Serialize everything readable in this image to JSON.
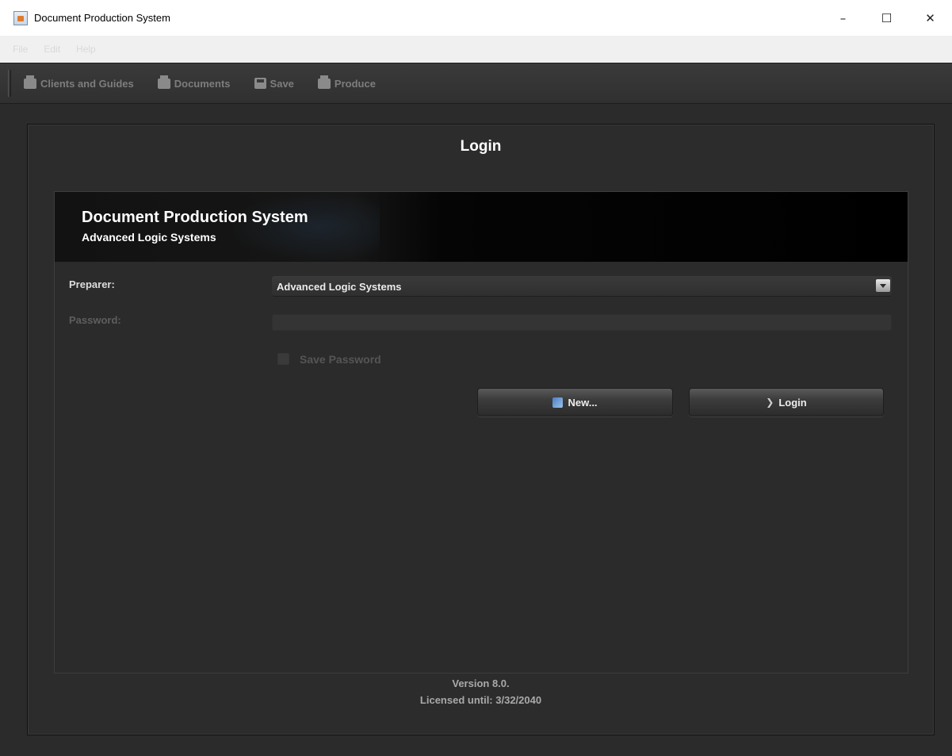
{
  "window": {
    "title": "Document Production System",
    "minimize": "–",
    "maximize": "☐",
    "close": "✕"
  },
  "menu": [
    "File",
    "Edit",
    "Help"
  ],
  "toolbar": {
    "clients": "Clients and Guides",
    "documents": "Documents",
    "save": "Save",
    "produce": "Produce"
  },
  "login": {
    "title": "Login",
    "banner_title": "Document Production System",
    "banner_subtitle": "Advanced Logic Systems",
    "preparer_label": "Preparer:",
    "preparer_value": "Advanced Logic Systems",
    "password_label": "Password:",
    "password_value": "",
    "save_password_label": "Save Password",
    "save_password_checked": false,
    "new_button": "New...",
    "login_button": "Login"
  },
  "footer": {
    "version": "Version 8.0.",
    "license": "Licensed until: 3/32/2040"
  },
  "colors": {
    "background": "#2b2b2b",
    "banner": "#000000",
    "disabled_text": "#5e5e5e"
  }
}
